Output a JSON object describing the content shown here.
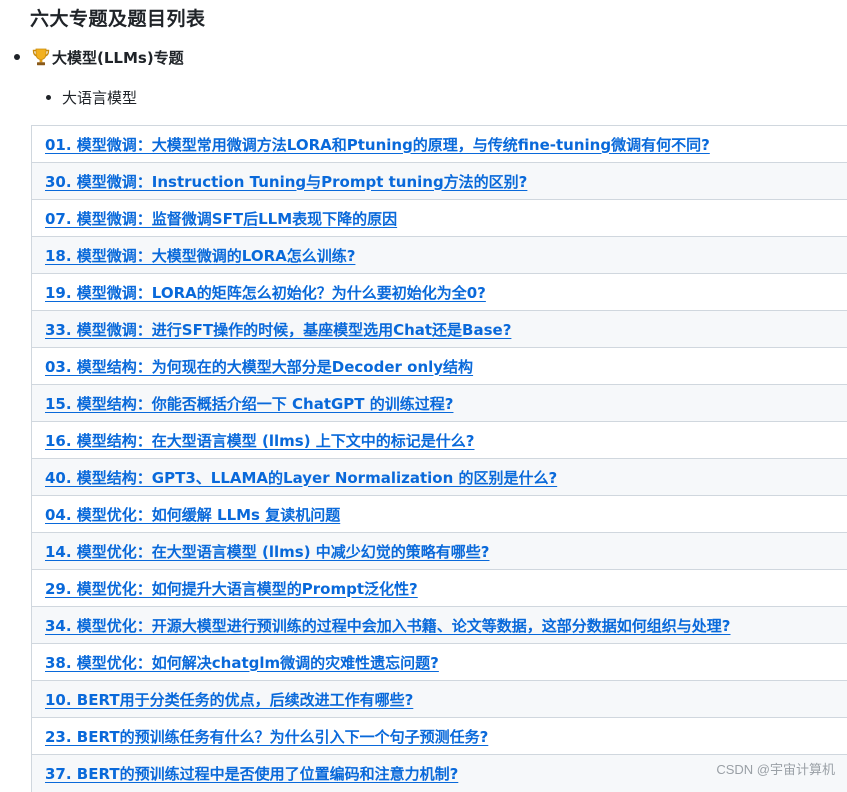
{
  "page": {
    "title": "六大专题及题目列表"
  },
  "topic": {
    "icon": "trophy-icon",
    "label": "大模型(LLMs)专题"
  },
  "subtopic": {
    "label": "大语言模型"
  },
  "questions": [
    "01. 模型微调：大模型常用微调方法LORA和Ptuning的原理，与传统fine-tuning微调有何不同?",
    "30. 模型微调：Instruction Tuning与Prompt tuning方法的区别?",
    "07. 模型微调：监督微调SFT后LLM表现下降的原因",
    "18. 模型微调：大模型微调的LORA怎么训练?",
    "19. 模型微调：LORA的矩阵怎么初始化？为什么要初始化为全0?",
    "33. 模型微调：进行SFT操作的时候，基座模型选用Chat还是Base?",
    "03. 模型结构：为何现在的大模型大部分是Decoder only结构",
    "15. 模型结构：你能否概括介绍一下 ChatGPT 的训练过程?",
    "16. 模型结构：在大型语言模型 (llms) 上下文中的标记是什么?",
    "40. 模型结构：GPT3、LLAMA的Layer Normalization 的区别是什么?",
    "04. 模型优化：如何缓解 LLMs 复读机问题",
    "14. 模型优化：在大型语言模型 (llms) 中减少幻觉的策略有哪些?",
    "29. 模型优化：如何提升大语言模型的Prompt泛化性?",
    "34. 模型优化：开源大模型进行预训练的过程中会加入书籍、论文等数据，这部分数据如何组织与处理?",
    "38. 模型优化：如何解决chatglm微调的灾难性遗忘问题?",
    "10. BERT用于分类任务的优点，后续改进工作有哪些?",
    "23. BERT的预训练任务有什么？为什么引入下一个句子预测任务?",
    "37. BERT的预训练过程中是否使用了位置编码和注意力机制?"
  ],
  "watermark": "CSDN @宇宙计算机",
  "colors": {
    "link": "#0969da",
    "stripe": "#f6f8fa",
    "border": "#d0d7de"
  }
}
